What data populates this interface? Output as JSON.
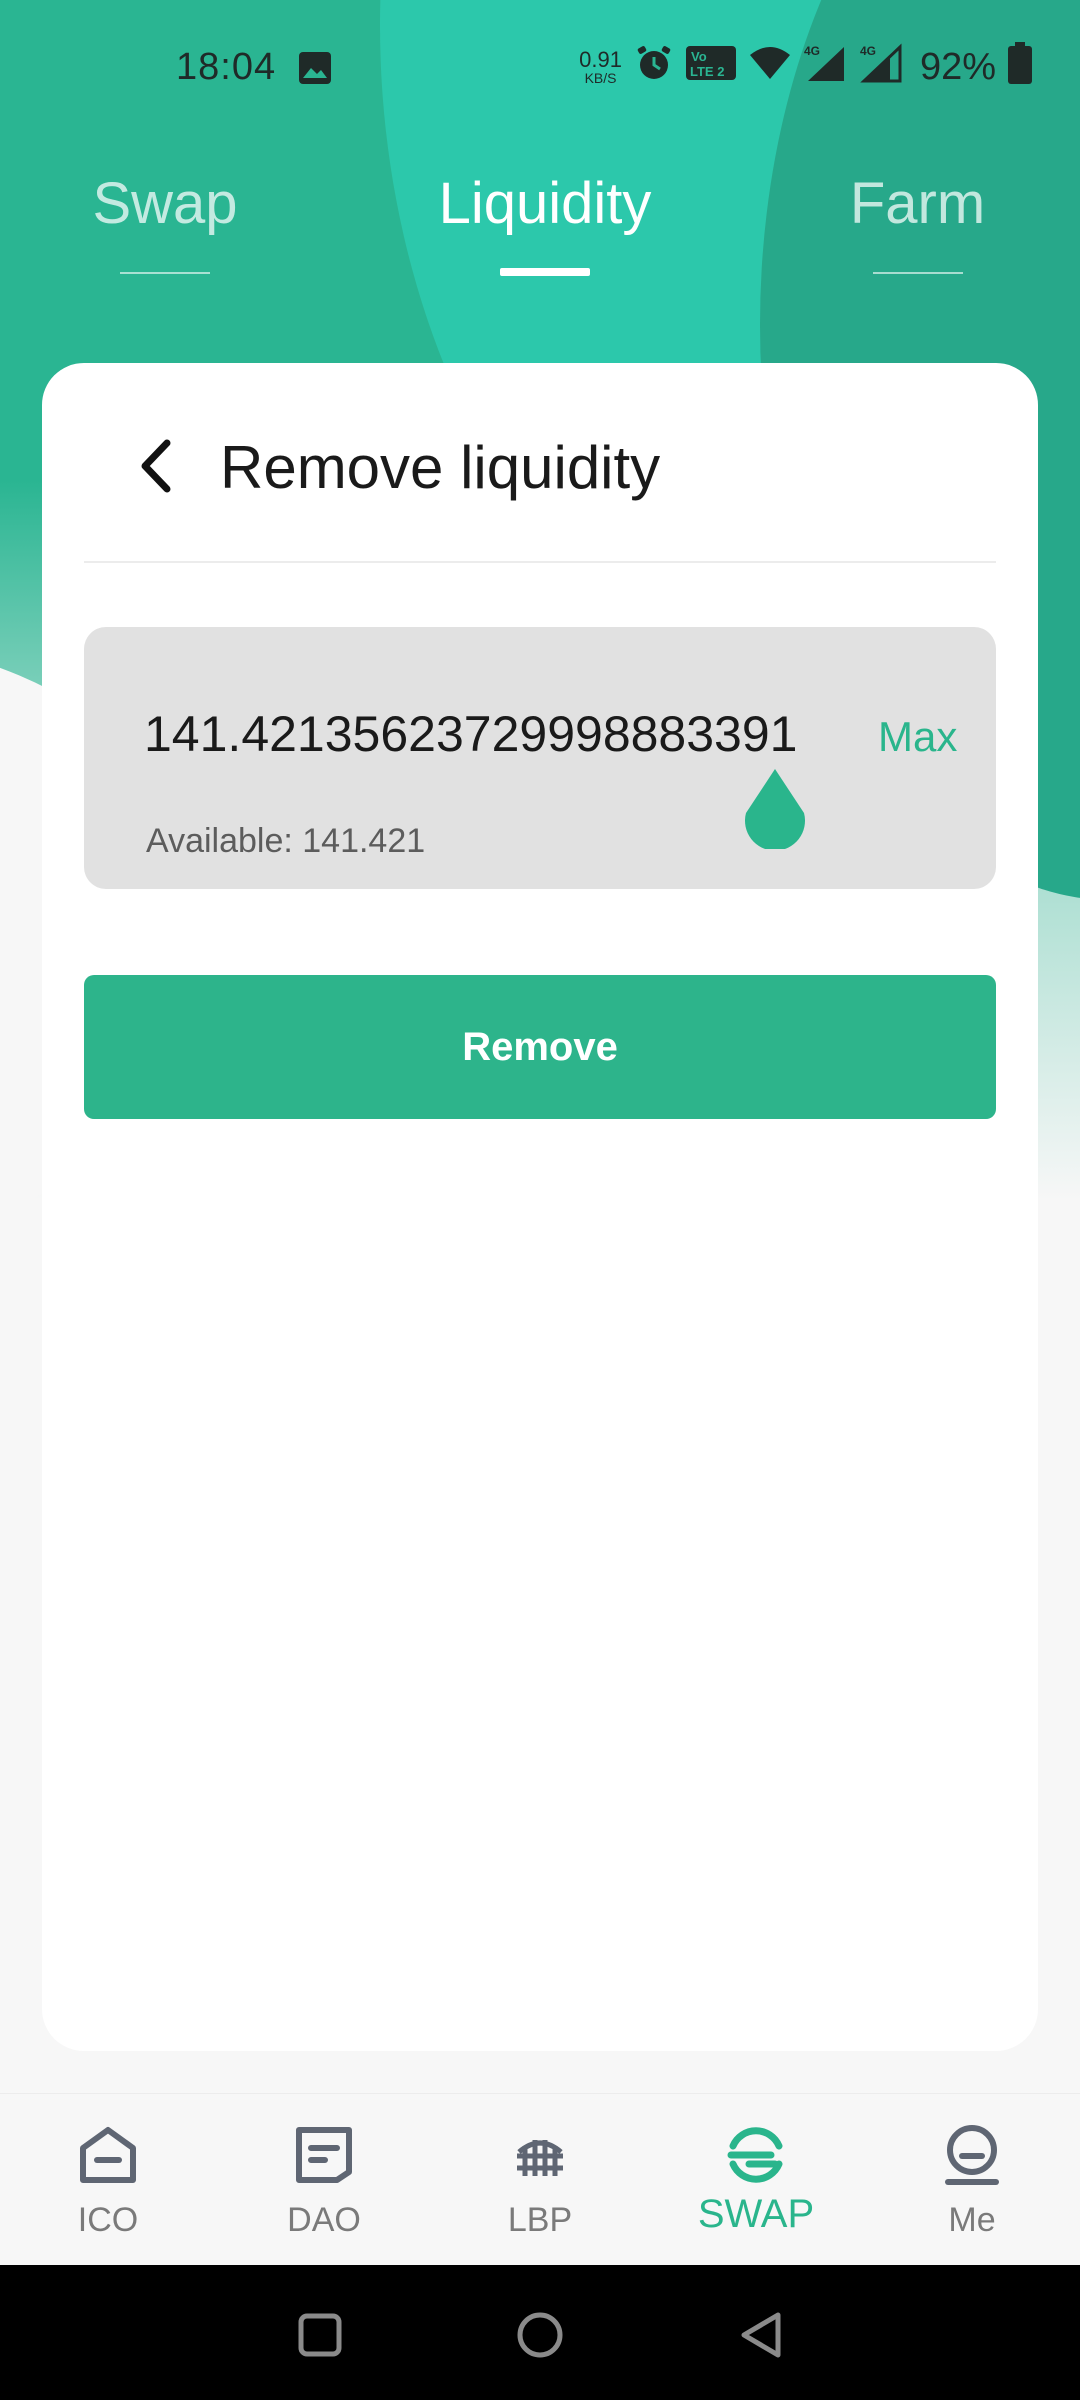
{
  "status_bar": {
    "time": "18:04",
    "net_speed_value": "0.91",
    "net_speed_unit": "KB/S",
    "volte_label": "Vo LTE 2",
    "signal1_label": "4G",
    "signal2_label": "4G",
    "battery": "92%"
  },
  "tabs": [
    {
      "label": "Swap",
      "active": false
    },
    {
      "label": "Liquidity",
      "active": true
    },
    {
      "label": "Farm",
      "active": false
    }
  ],
  "card": {
    "title": "Remove liquidity",
    "amount_value": "141.42135623729998883391",
    "max_label": "Max",
    "available_text": "Available: 141.421",
    "remove_label": "Remove"
  },
  "bottom_nav": [
    {
      "label": "ICO",
      "icon": "ico-icon",
      "active": false
    },
    {
      "label": "DAO",
      "icon": "dao-icon",
      "active": false
    },
    {
      "label": "LBP",
      "icon": "lbp-icon",
      "active": false
    },
    {
      "label": "SWAP",
      "icon": "swap-icon",
      "active": true
    },
    {
      "label": "Me",
      "icon": "me-icon",
      "active": false
    }
  ],
  "colors": {
    "accent": "#2ab58c",
    "header_green": "#2ab592",
    "button_green": "#2db48b"
  }
}
